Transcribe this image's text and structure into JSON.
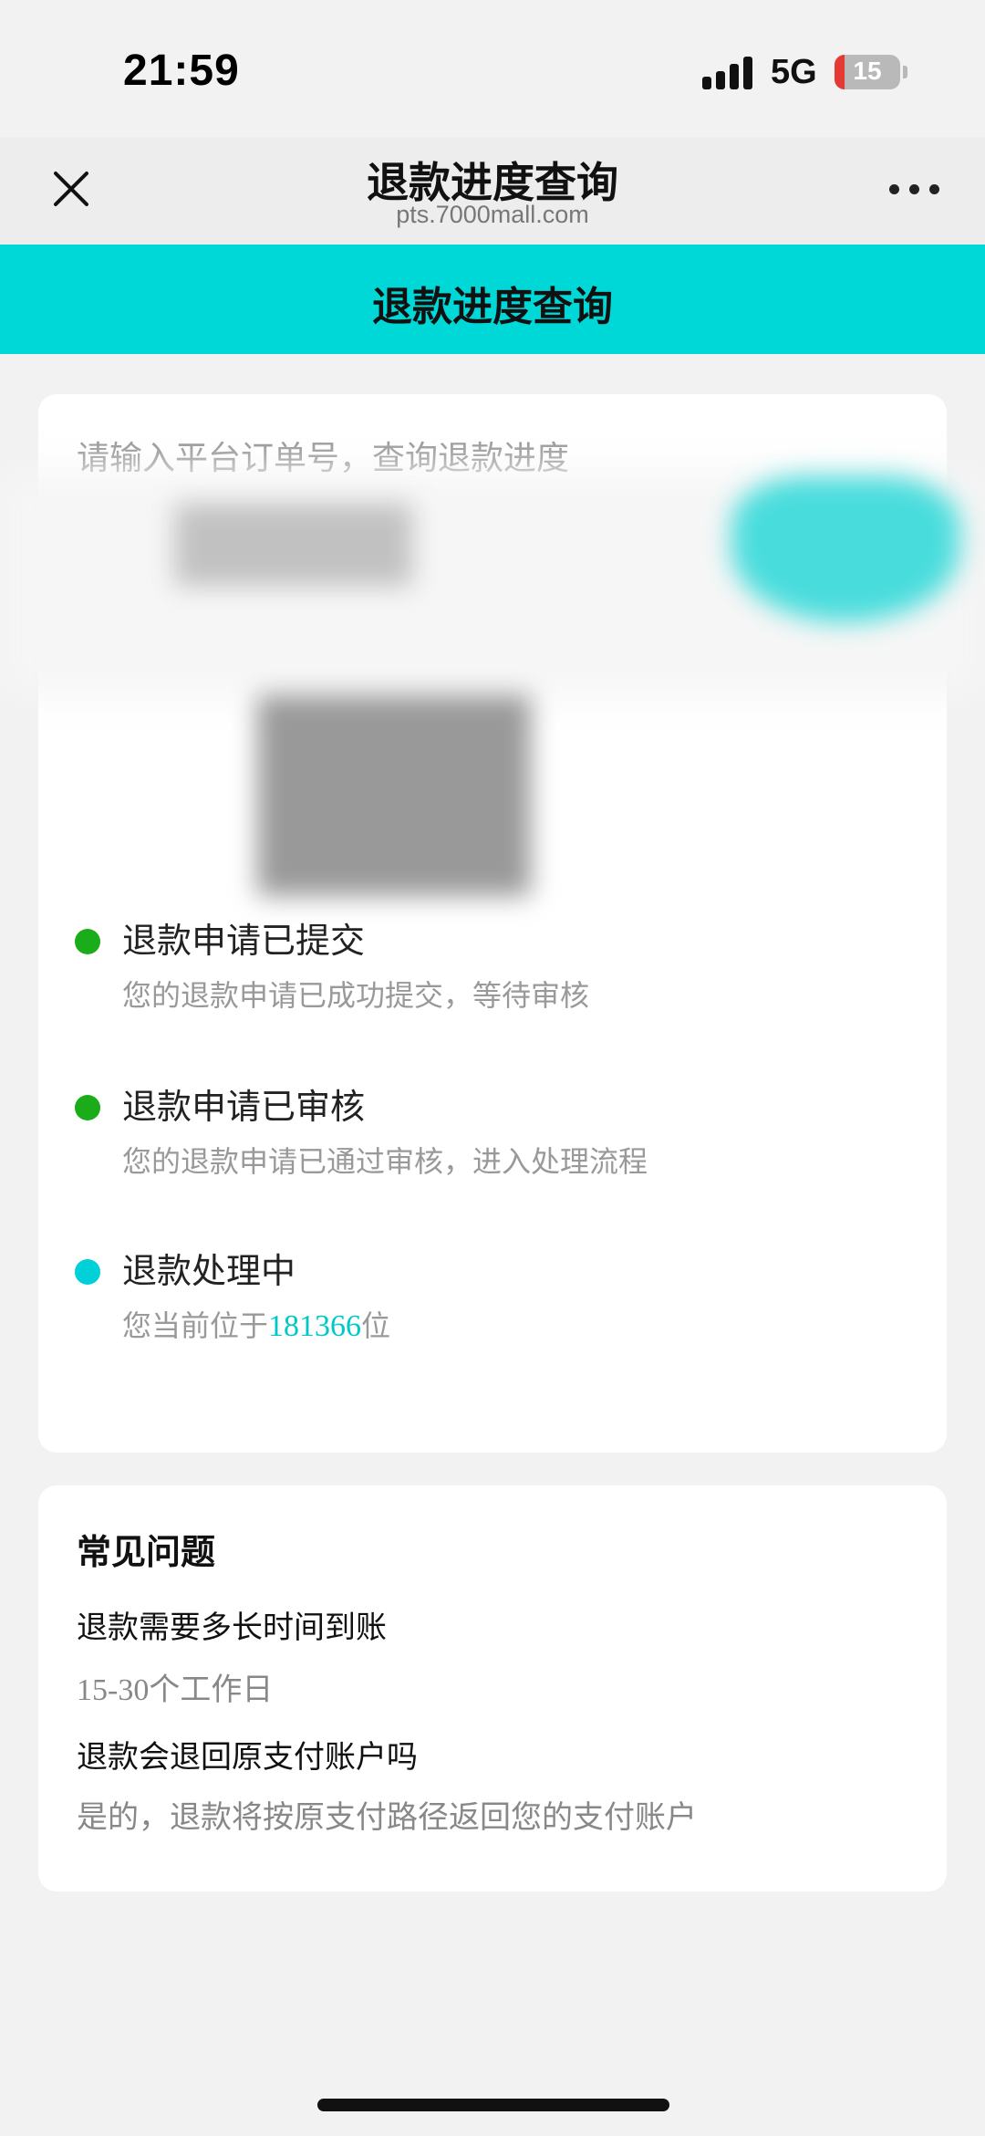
{
  "status_bar": {
    "time": "21:59",
    "network": "5G",
    "battery": "15",
    "battery_level": 0.15,
    "battery_color": "#e53935"
  },
  "nav": {
    "title": "退款进度查询",
    "url": "pts.7000mall.com",
    "close_icon": "close-icon",
    "more_icon": "more-icon"
  },
  "header": {
    "title": "退款进度查询",
    "background": "#00d8d8"
  },
  "query": {
    "placeholder": "请输入平台订单号，查询退款进度",
    "value": ""
  },
  "timeline": [
    {
      "title": "退款申请已提交",
      "desc": "您的退款申请已成功提交，等待审核",
      "status_color": "#1aad19"
    },
    {
      "title": "退款申请已审核",
      "desc": "您的退款申请已通过审核，进入处理流程",
      "status_color": "#1aad19"
    },
    {
      "title": "退款处理中",
      "desc_prefix": "您当前位于",
      "rank": "181366",
      "desc_suffix": "位",
      "status_color": "#00d0d8"
    }
  ],
  "faq": {
    "title": "常见问题",
    "items": [
      {
        "question": "退款需要多长时间到账",
        "answer": "15-30个工作日"
      },
      {
        "question": "退款会退回原支付账户吗",
        "answer": "是的，退款将按原支付路径返回您的支付账户"
      }
    ]
  }
}
